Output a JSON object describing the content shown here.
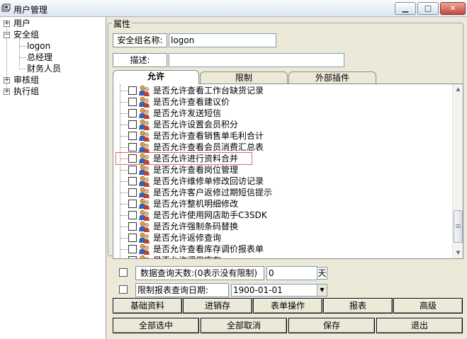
{
  "window": {
    "title": "用户管理",
    "min_glyph": "▁",
    "max_glyph": "□",
    "close_glyph": "✕"
  },
  "tree": {
    "items": [
      {
        "label": "用户",
        "expander": "+"
      },
      {
        "label": "安全组",
        "expander": "−"
      },
      {
        "label": "logon"
      },
      {
        "label": "总经理"
      },
      {
        "label": "财务人员"
      },
      {
        "label": "审核组",
        "expander": "+"
      },
      {
        "label": "执行组",
        "expander": "+"
      }
    ]
  },
  "properties": {
    "group_title": "属性",
    "name_label": "安全组名称:",
    "name_value": "logon",
    "desc_label": "描述:",
    "desc_value": ""
  },
  "tabs": [
    {
      "label": "允许",
      "active": true
    },
    {
      "label": "限制",
      "active": false
    },
    {
      "label": "外部插件",
      "active": false
    }
  ],
  "permissions": [
    "是否允许查看工作台缺货记录",
    "是否允许查看建议价",
    "是否允许发送短信",
    "是否允许设置会员积分",
    "是否允许查看销售单毛利合计",
    "是否允许查看会员消费汇总表",
    "是否允许进行资料合并",
    "是否允许查看岗位管理",
    "是否允许维修单修改回访记录",
    "是否允许客户返修过期短信提示",
    "是否允许整机明细修改",
    "是否允许使用网店助手C3SDK",
    "是否允许强制条码替换",
    "是否允许返修查询",
    "是否允许查看库存调价报表单",
    "是否允许调用库存"
  ],
  "scroll": {
    "up": "▲",
    "down": "▼"
  },
  "query_days": {
    "label": "数据查询天数:(0表示没有限制)",
    "value": "0",
    "unit": "天"
  },
  "report_date": {
    "label": "限制报表查询日期:",
    "value": "1900-01-01",
    "arrow": "▼"
  },
  "category_buttons": [
    "基础资料",
    "进销存",
    "表单操作",
    "报表",
    "高级"
  ],
  "action_buttons": [
    "全部选中",
    "全部取消",
    "保存",
    "退出"
  ]
}
